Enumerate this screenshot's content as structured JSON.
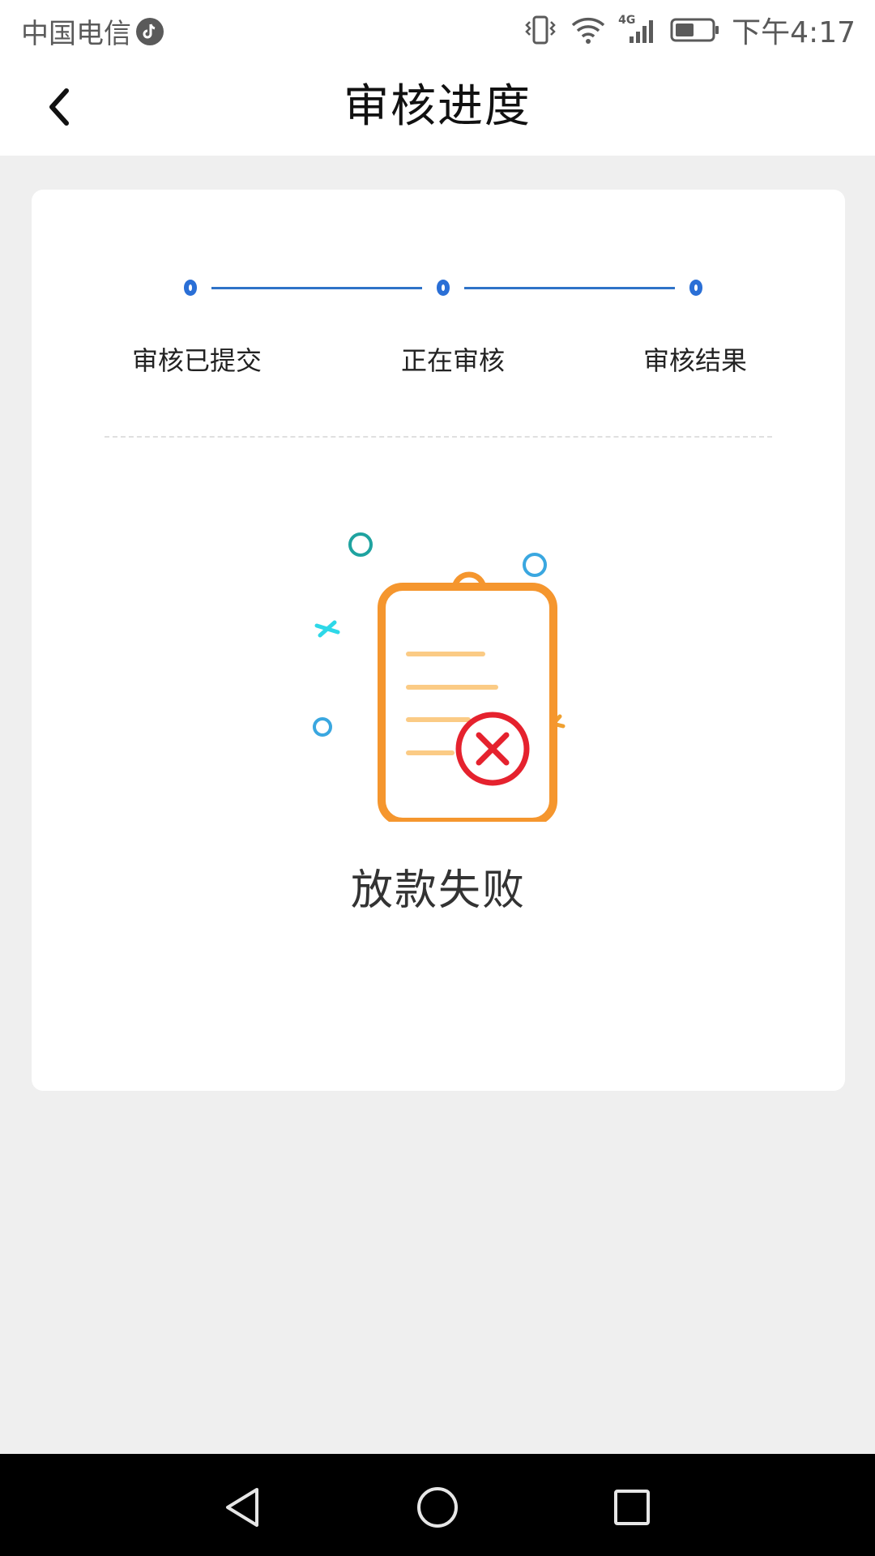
{
  "status_bar": {
    "carrier": "中国电信",
    "time": "下午4:17",
    "network_label": "4G",
    "icons": [
      "tiktok-icon",
      "vibrate-icon",
      "wifi-icon",
      "signal-icon",
      "battery-icon"
    ]
  },
  "header": {
    "title": "审核进度",
    "back_icon": "chevron-left-icon"
  },
  "progress": {
    "steps": [
      {
        "label": "审核已提交"
      },
      {
        "label": "正在审核"
      },
      {
        "label": "审核结果"
      }
    ],
    "accent_color": "#2a6fd6"
  },
  "result": {
    "status_text": "放款失败",
    "icon": "clipboard-failed-icon",
    "colors": {
      "clipboard": "#f5962e",
      "error": "#e5222e",
      "line": "#fbcb85"
    }
  },
  "nav_bar": {
    "icons": [
      "back-triangle-icon",
      "home-circle-icon",
      "recents-square-icon"
    ]
  }
}
